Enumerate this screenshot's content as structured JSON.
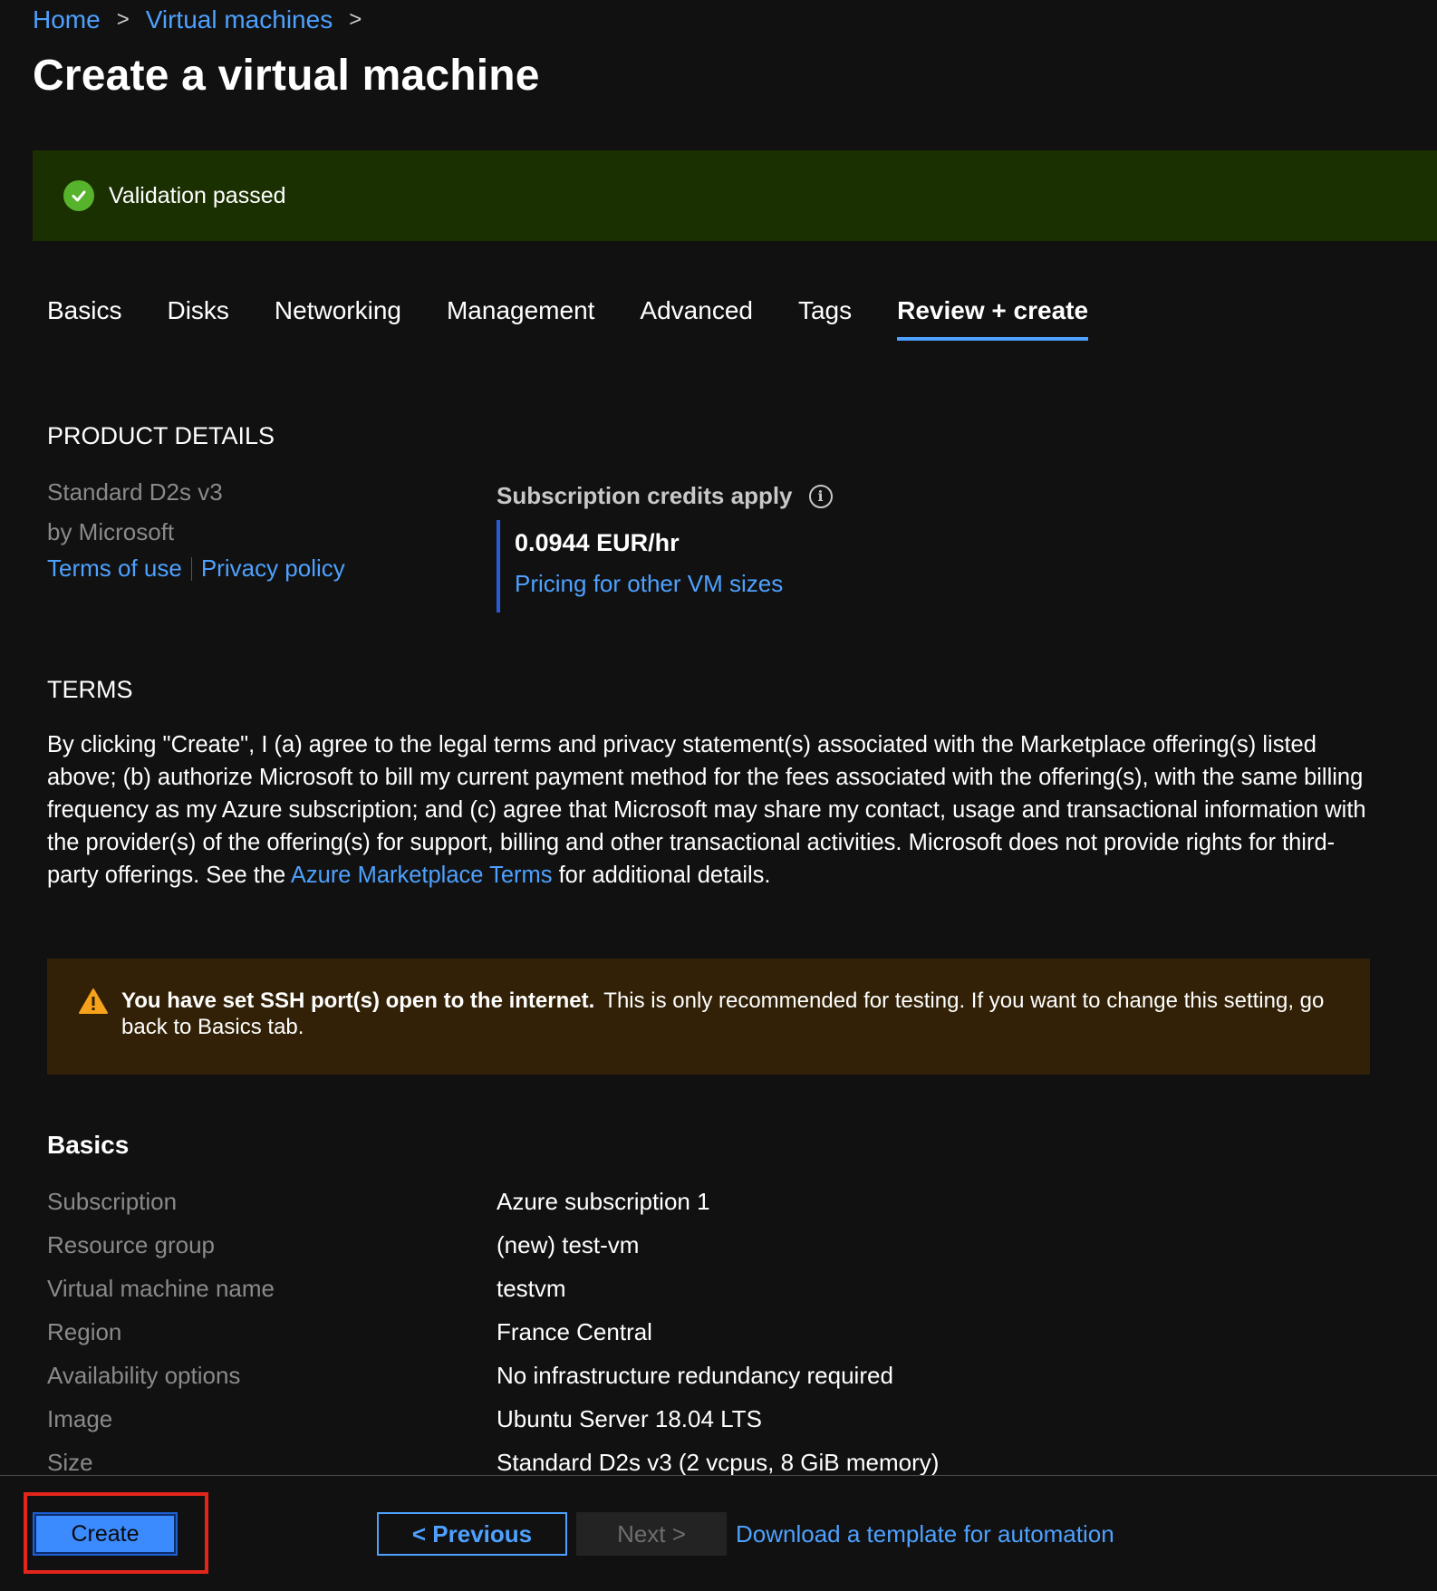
{
  "breadcrumb": {
    "home": "Home",
    "virtual_machines": "Virtual machines",
    "separator": ">"
  },
  "page_title": "Create a virtual machine",
  "validation": {
    "text": "Validation passed",
    "icon": "check-circle-icon",
    "color": "#57b22c"
  },
  "tabs": [
    {
      "label": "Basics",
      "active": false
    },
    {
      "label": "Disks",
      "active": false
    },
    {
      "label": "Networking",
      "active": false
    },
    {
      "label": "Management",
      "active": false
    },
    {
      "label": "Advanced",
      "active": false
    },
    {
      "label": "Tags",
      "active": false
    },
    {
      "label": "Review + create",
      "active": true
    }
  ],
  "product_details": {
    "heading": "PRODUCT DETAILS",
    "name": "Standard D2s v3",
    "by": "by Microsoft",
    "terms_link": "Terms of use",
    "privacy_link": "Privacy policy",
    "credits_label": "Subscription credits apply",
    "info_glyph": "i",
    "price": "0.0944 EUR/hr",
    "pricing_link": "Pricing for other VM sizes"
  },
  "terms": {
    "heading": "TERMS",
    "text_before": "By clicking \"Create\", I (a) agree to the legal terms and privacy statement(s) associated with the Marketplace offering(s) listed above; (b) authorize Microsoft to bill my current payment method for the fees associated with the offering(s), with the same billing frequency as my Azure subscription; and (c) agree that Microsoft may share my contact, usage and transactional information with the provider(s) of the offering(s) for support, billing and other transactional activities. Microsoft does not provide rights for third-party offerings. See the ",
    "link": "Azure Marketplace Terms",
    "text_after": " for additional details."
  },
  "warning": {
    "bold": "You have set SSH port(s) open to the internet.",
    "text": "This is only recommended for testing.  If you want to change this setting, go back to Basics tab.",
    "icon": "warning-triangle-icon",
    "color": "#f7a21b"
  },
  "basics": {
    "heading": "Basics",
    "rows": [
      {
        "key": "Subscription",
        "value": "Azure subscription 1"
      },
      {
        "key": "Resource group",
        "value": "(new) test-vm"
      },
      {
        "key": "Virtual machine name",
        "value": "testvm"
      },
      {
        "key": "Region",
        "value": "France Central"
      },
      {
        "key": "Availability options",
        "value": "No infrastructure redundancy required"
      },
      {
        "key": "Image",
        "value": "Ubuntu Server 18.04 LTS"
      },
      {
        "key": "Size",
        "value": "Standard D2s v3 (2 vcpus, 8 GiB memory)"
      }
    ]
  },
  "footer": {
    "create": "Create",
    "previous": "< Previous",
    "next": "Next >",
    "download": "Download a template for automation"
  }
}
